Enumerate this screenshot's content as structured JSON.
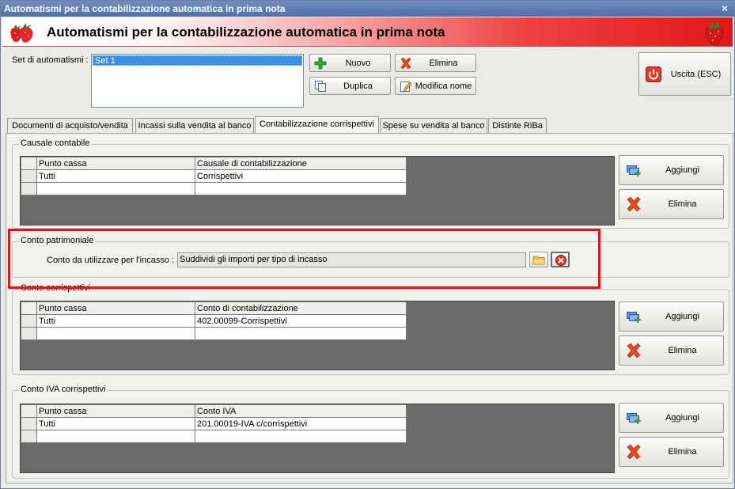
{
  "window": {
    "title": "Automatismi per la contabilizzazione automatica in prima nota",
    "close_glyph": "×"
  },
  "header": {
    "title": "Automatismi per la contabilizzazione automatica in prima nota"
  },
  "automatismi": {
    "label": "Set di automatismi :",
    "items": [
      "Set 1"
    ],
    "buttons": {
      "nuovo": "Nuovo",
      "elimina": "Elimina",
      "duplica": "Duplica",
      "modifica_nome": "Modifica nome"
    }
  },
  "exit_button": "Uscita (ESC)",
  "tabs": [
    "Documenti di acquisto/vendita",
    "Incassi sulla vendita al banco",
    "Contabilizzazione corrispettivi",
    "Spese su vendita al banco",
    "Distinte RiBa"
  ],
  "active_tab": "Contabilizzazione corrispettivi",
  "causale": {
    "legend": "Causale contabile",
    "columns": [
      "Punto cassa",
      "Causale di contabilizzazione"
    ],
    "rows": [
      [
        "Tutti",
        "Corrispettivi"
      ],
      [
        "",
        ""
      ]
    ],
    "add_label": "Aggiungi",
    "delete_label": "Elimina"
  },
  "patrimoniale": {
    "legend": "Conto patrimoniale",
    "label": "Conto da utilizzare per l'incasso :",
    "value": "Suddividi gli importi per tipo di incasso"
  },
  "corrispettivi": {
    "legend": "Conto corrispettivi",
    "columns": [
      "Punto cassa",
      "Conto di contabilizzazione"
    ],
    "rows": [
      [
        "Tutti",
        "402.00099-Corrispettivi"
      ],
      [
        "",
        ""
      ]
    ],
    "add_label": "Aggiungi",
    "delete_label": "Elimina"
  },
  "iva": {
    "legend": "Conto IVA corrispettivi",
    "columns": [
      "Punto cassa",
      "Conto IVA"
    ],
    "rows": [
      [
        "Tutti",
        "201.00019-IVA c/corrispettivi"
      ],
      [
        "",
        ""
      ]
    ],
    "add_label": "Aggiungi",
    "delete_label": "Elimina"
  },
  "colors": {
    "accent_red": "#e01818",
    "highlight": "#e01414",
    "titlebar": "#4e6fa8",
    "selection": "#3e8fe0"
  }
}
